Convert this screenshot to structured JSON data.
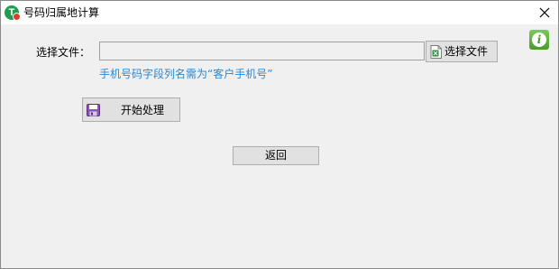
{
  "window": {
    "title": "号码归属地计算"
  },
  "form": {
    "select_file_label": "选择文件：",
    "file_path_value": "",
    "select_file_button": "选择文件",
    "hint": "手机号码字段列名需为“客户手机号”",
    "start_button": "开始处理",
    "back_button": "返回"
  },
  "icons": {
    "app": "app-logo-icon",
    "close": "close-icon",
    "file": "excel-file-icon",
    "start": "floppy-disk-icon",
    "info": "info-icon"
  },
  "colors": {
    "hint": "#2b87d1",
    "info_green": "#4a9b2c",
    "app_green": "#1f9e4f"
  }
}
